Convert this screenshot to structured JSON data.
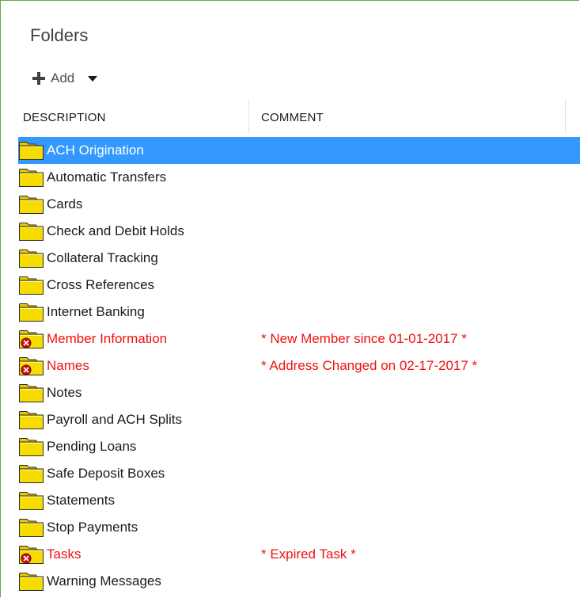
{
  "panel": {
    "title": "Folders"
  },
  "toolbar": {
    "add_label": "Add",
    "add_icon": "plus-icon",
    "dropdown_icon": "caret-down-icon"
  },
  "columns": {
    "description": "DESCRIPTION",
    "comment": "COMMENT"
  },
  "colors": {
    "selection": "#3399ff",
    "alert_text": "#ee1111",
    "folder": "#f5d800",
    "panel_border": "#6aaa3a"
  },
  "folders": [
    {
      "description": "ACH Origination",
      "comment": "",
      "selected": true,
      "alert": false
    },
    {
      "description": "Automatic Transfers",
      "comment": "",
      "selected": false,
      "alert": false
    },
    {
      "description": "Cards",
      "comment": "",
      "selected": false,
      "alert": false
    },
    {
      "description": "Check and Debit Holds",
      "comment": "",
      "selected": false,
      "alert": false
    },
    {
      "description": "Collateral Tracking",
      "comment": "",
      "selected": false,
      "alert": false
    },
    {
      "description": "Cross References",
      "comment": "",
      "selected": false,
      "alert": false
    },
    {
      "description": "Internet Banking",
      "comment": "",
      "selected": false,
      "alert": false
    },
    {
      "description": "Member Information",
      "comment": "* New Member since 01-01-2017 *",
      "selected": false,
      "alert": true
    },
    {
      "description": "Names",
      "comment": "* Address Changed on 02-17-2017 *",
      "selected": false,
      "alert": true
    },
    {
      "description": "Notes",
      "comment": "",
      "selected": false,
      "alert": false
    },
    {
      "description": "Payroll and ACH Splits",
      "comment": "",
      "selected": false,
      "alert": false
    },
    {
      "description": "Pending Loans",
      "comment": "",
      "selected": false,
      "alert": false
    },
    {
      "description": "Safe Deposit Boxes",
      "comment": "",
      "selected": false,
      "alert": false
    },
    {
      "description": "Statements",
      "comment": "",
      "selected": false,
      "alert": false
    },
    {
      "description": "Stop Payments",
      "comment": "",
      "selected": false,
      "alert": false
    },
    {
      "description": "Tasks",
      "comment": "* Expired Task *",
      "selected": false,
      "alert": true
    },
    {
      "description": "Warning Messages",
      "comment": "",
      "selected": false,
      "alert": false
    }
  ]
}
